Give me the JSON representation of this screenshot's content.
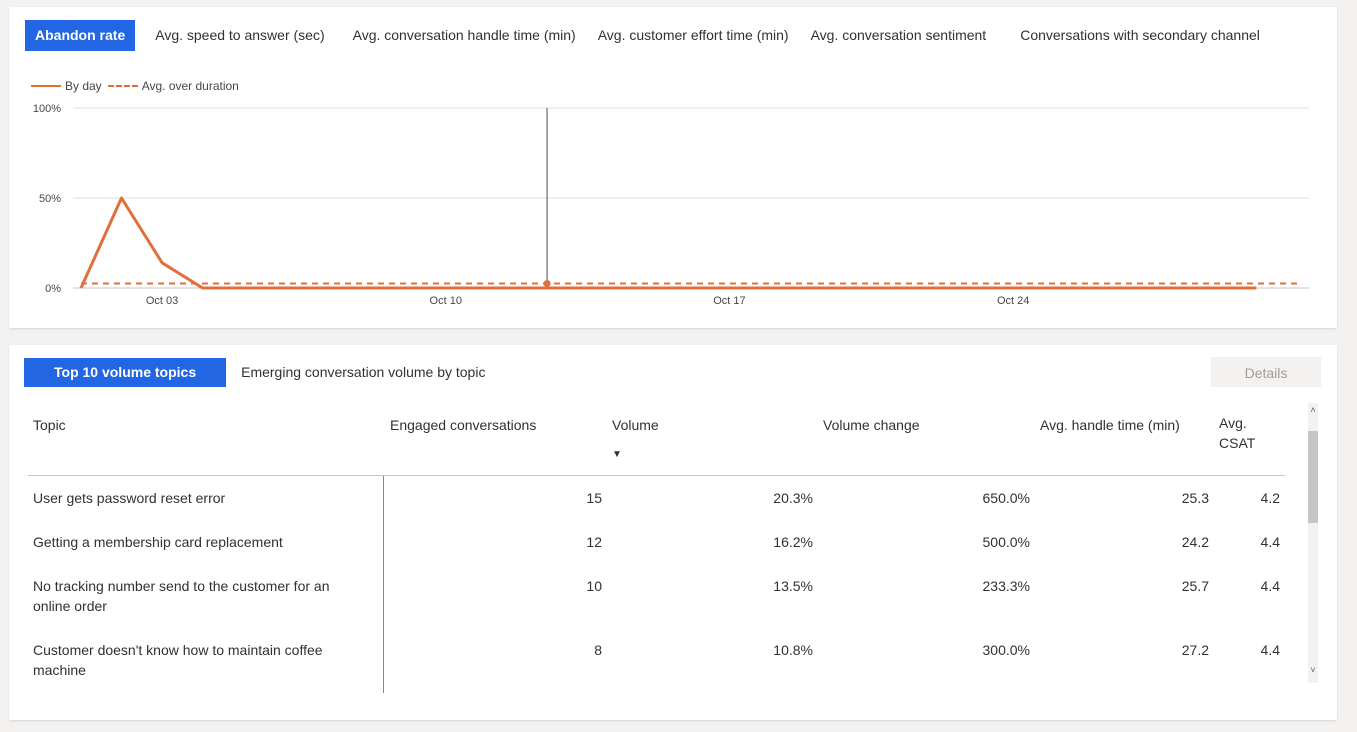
{
  "metric_tabs": {
    "abandon_rate": "Abandon rate",
    "avg_speed": "Avg. speed to answer (sec)",
    "avg_handle": "Avg. conversation handle time (min)",
    "avg_effort": "Avg. customer effort time (min)",
    "avg_sentiment": "Avg. conversation sentiment",
    "secondary_channel": "Conversations with secondary channel"
  },
  "legend": {
    "by_day": "By day",
    "avg_duration": "Avg. over duration"
  },
  "colors": {
    "accent": "#2266e3",
    "series": "#e0703a",
    "grid": "#e1dfdd"
  },
  "chart_data": {
    "type": "line",
    "y_ticks": [
      "0%",
      "50%",
      "100%"
    ],
    "ylim": [
      0,
      100
    ],
    "x_ticks": [
      {
        "label": "Oct 03",
        "day": 3
      },
      {
        "label": "Oct 10",
        "day": 10
      },
      {
        "label": "Oct 17",
        "day": 17
      },
      {
        "label": "Oct 24",
        "day": 24
      }
    ],
    "xlim": [
      1,
      31
    ],
    "series": [
      {
        "name": "By day",
        "style": "solid",
        "points": [
          [
            1,
            0
          ],
          [
            2,
            50
          ],
          [
            3,
            14
          ],
          [
            4,
            0
          ],
          [
            5,
            0
          ],
          [
            6,
            0
          ],
          [
            7,
            0
          ],
          [
            8,
            0
          ],
          [
            9,
            0
          ],
          [
            10,
            0
          ],
          [
            11,
            0
          ],
          [
            12,
            0
          ],
          [
            13,
            0
          ],
          [
            14,
            0
          ],
          [
            15,
            0
          ],
          [
            16,
            0
          ],
          [
            17,
            0
          ],
          [
            18,
            0
          ],
          [
            19,
            0
          ],
          [
            20,
            0
          ],
          [
            21,
            0
          ],
          [
            22,
            0
          ],
          [
            23,
            0
          ],
          [
            24,
            0
          ],
          [
            25,
            0
          ],
          [
            26,
            0
          ],
          [
            27,
            0
          ],
          [
            28,
            0
          ],
          [
            29,
            0
          ],
          [
            30,
            0
          ]
        ]
      },
      {
        "name": "Avg. over duration",
        "style": "dashed",
        "value": 2.5
      }
    ],
    "hover_day": 12.5
  },
  "topic_tabs": {
    "top10": "Top 10 volume topics",
    "emerging": "Emerging conversation volume by topic",
    "details": "Details"
  },
  "table": {
    "headers": {
      "topic": "Topic",
      "engaged": "Engaged conversations",
      "volume": "Volume",
      "volume_change": "Volume change",
      "handle": "Avg. handle time (min)",
      "csat_1": "Avg.",
      "csat_2": "CSAT"
    },
    "rows": [
      {
        "topic": "User gets password reset error",
        "engaged": "15",
        "volume": "20.3%",
        "change": "650.0%",
        "handle": "25.3",
        "csat": "4.2"
      },
      {
        "topic": "Getting a membership card replacement",
        "engaged": "12",
        "volume": "16.2%",
        "change": "500.0%",
        "handle": "24.2",
        "csat": "4.4"
      },
      {
        "topic": "No tracking number send to the customer for an online order",
        "engaged": "10",
        "volume": "13.5%",
        "change": "233.3%",
        "handle": "25.7",
        "csat": "4.4"
      },
      {
        "topic": "Customer doesn't know how to maintain coffee machine",
        "engaged": "8",
        "volume": "10.8%",
        "change": "300.0%",
        "handle": "27.2",
        "csat": "4.4"
      }
    ]
  }
}
